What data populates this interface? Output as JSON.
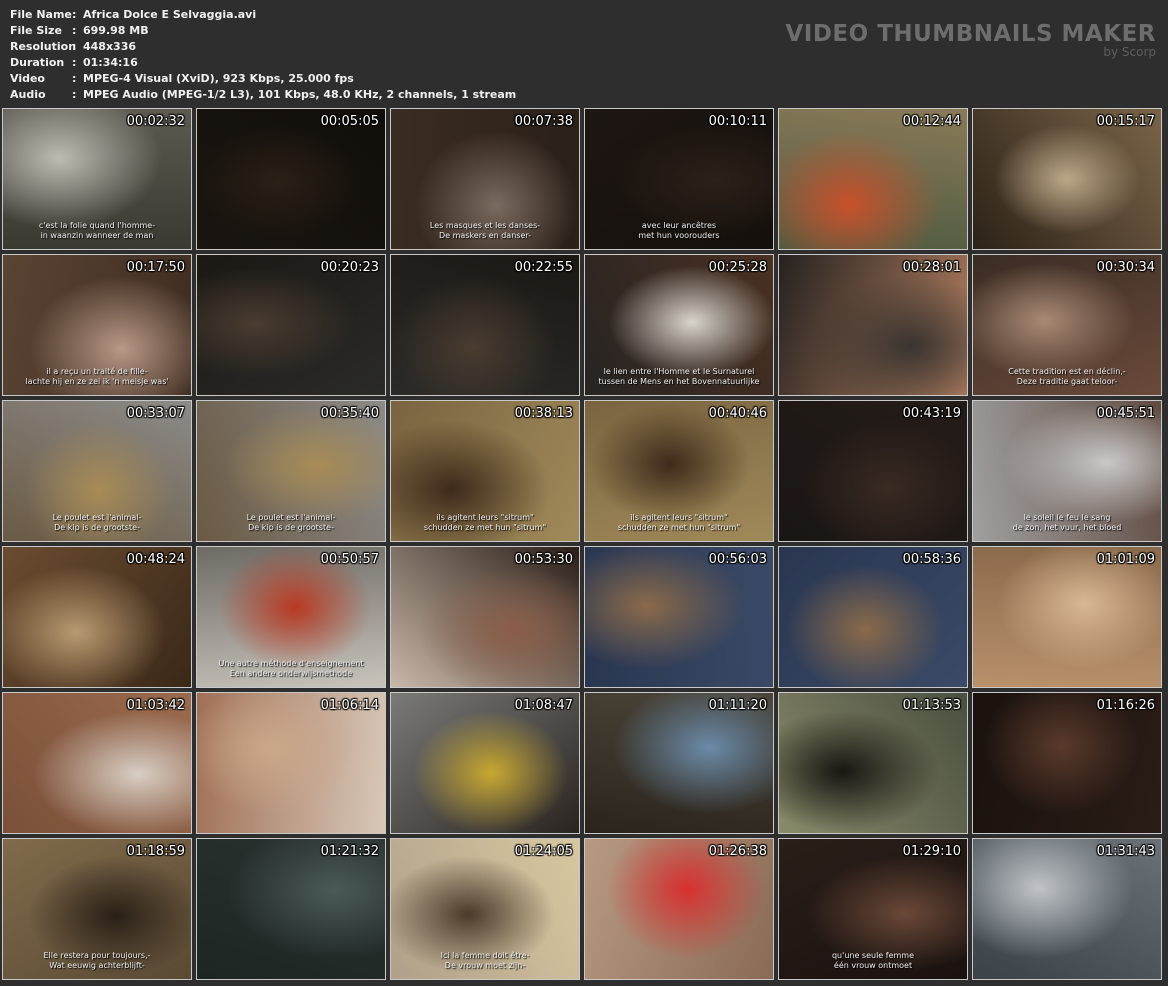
{
  "file_info": [
    {
      "key": "File Name",
      "value": "Africa Dolce E Selvaggia.avi"
    },
    {
      "key": "File Size",
      "value": "699.98 MB"
    },
    {
      "key": "Resolution",
      "value": "448x336"
    },
    {
      "key": "Duration",
      "value": "01:34:16"
    },
    {
      "key": "Video",
      "value": "MPEG-4 Visual (XviD), 923 Kbps, 25.000 fps"
    },
    {
      "key": "Audio",
      "value": "MPEG Audio (MPEG-1/2 L3), 101 Kbps, 48.0 KHz, 2 channels, 1 stream"
    }
  ],
  "separator": ":",
  "brand": {
    "title": "VIDEO THUMBNAILS MAKER",
    "subtitle": "by Scorp"
  },
  "thumbnails": [
    {
      "time": "00:02:32",
      "subtitle": "c'est la folie quand l'homme-\nin waanzin wanneer de man",
      "colors": [
        "#3a3a32",
        "#bdbbb2",
        "#5c5a50"
      ]
    },
    {
      "time": "00:05:05",
      "subtitle": "",
      "colors": [
        "#1a1510",
        "#2a2016",
        "#120e0a"
      ]
    },
    {
      "time": "00:07:38",
      "subtitle": "Les masques et les danses-\nDe maskers en danser-",
      "colors": [
        "#3b2c22",
        "#7a6a60",
        "#2a2018"
      ]
    },
    {
      "time": "00:10:11",
      "subtitle": "avec leur ancêtres\nmet hun voorouders",
      "colors": [
        "#1d1612",
        "#2c2119",
        "#15100c"
      ]
    },
    {
      "time": "00:12:44",
      "subtitle": "",
      "colors": [
        "#8a7a58",
        "#c8502a",
        "#4c5a40"
      ]
    },
    {
      "time": "00:15:17",
      "subtitle": "",
      "colors": [
        "#7a6448",
        "#bca888",
        "#2c2218"
      ]
    },
    {
      "time": "00:17:50",
      "subtitle": "il a reçu un traité de fille-\nlachte hij en ze zei ik 'n meisje was'",
      "colors": [
        "#3e2c20",
        "#b89886",
        "#5a4434"
      ]
    },
    {
      "time": "00:20:23",
      "subtitle": "",
      "colors": [
        "#2a2a28",
        "#4a3c30",
        "#1c1814"
      ]
    },
    {
      "time": "00:22:55",
      "subtitle": "",
      "colors": [
        "#2a2a28",
        "#4a3c30",
        "#1c1814"
      ]
    },
    {
      "time": "00:25:28",
      "subtitle": "le lien entre l'Homme et le Surnaturel\ntussen de Mens en het Bovennatuurlijke",
      "colors": [
        "#262422",
        "#d8d4cc",
        "#4a3022"
      ]
    },
    {
      "time": "00:28:01",
      "subtitle": "",
      "colors": [
        "#262220",
        "#3a3430",
        "#b48060"
      ]
    },
    {
      "time": "00:30:34",
      "subtitle": "Cette tradition est en déclin,-\nDeze traditie gaat teloor-",
      "colors": [
        "#3a2c24",
        "#a88a74",
        "#6a4a3a"
      ]
    },
    {
      "time": "00:33:07",
      "subtitle": "Le poulet est l'animal-\nDe kip is de grootste-",
      "colors": [
        "#8c8a88",
        "#a88c56",
        "#6a5a44"
      ]
    },
    {
      "time": "00:35:40",
      "subtitle": "Le poulet est l'animal-\nDe kip is de grootste-",
      "colors": [
        "#8c8a88",
        "#a88c56",
        "#6a5a44"
      ]
    },
    {
      "time": "00:38:13",
      "subtitle": "ils agitent leurs \"sitrum\"\nschudden ze met hun \"sitrum\"",
      "colors": [
        "#a08a5a",
        "#3e2a1a",
        "#7a6440"
      ]
    },
    {
      "time": "00:40:46",
      "subtitle": "ils agitent leurs \"sitrum\"\nschudden ze met hun \"sitrum\"",
      "colors": [
        "#a08a5a",
        "#3e2a1a",
        "#7a6440"
      ]
    },
    {
      "time": "00:43:19",
      "subtitle": "",
      "colors": [
        "#1a1614",
        "#3a2a22",
        "#241c18"
      ]
    },
    {
      "time": "00:45:51",
      "subtitle": "le soleil le feu le sang\nde zon, het vuur, het bloed",
      "colors": [
        "#a0a0a0",
        "#c8c8c8",
        "#604a40"
      ]
    },
    {
      "time": "00:48:24",
      "subtitle": "",
      "colors": [
        "#6a4c30",
        "#b89a70",
        "#3a2818"
      ]
    },
    {
      "time": "00:50:57",
      "subtitle": "Une autre méthode d'enseignement\nEen andere onderwijsmethode",
      "colors": [
        "#6e6a64",
        "#b83a22",
        "#c8c4bc"
      ]
    },
    {
      "time": "00:53:30",
      "subtitle": "",
      "colors": [
        "#2a1e18",
        "#8a5e48",
        "#c8b8a8"
      ]
    },
    {
      "time": "00:56:03",
      "subtitle": "",
      "colors": [
        "#3a4a66",
        "#8a6a4a",
        "#2a3650"
      ]
    },
    {
      "time": "00:58:36",
      "subtitle": "",
      "colors": [
        "#3a4a66",
        "#8a6a4a",
        "#2a3650"
      ]
    },
    {
      "time": "01:01:09",
      "subtitle": "",
      "colors": [
        "#b8906a",
        "#d8b894",
        "#8a6a4c"
      ]
    },
    {
      "time": "01:03:42",
      "subtitle": "",
      "colors": [
        "#7a5038",
        "#d8cec4",
        "#9a6a4e"
      ]
    },
    {
      "time": "01:06:14",
      "subtitle": "",
      "colors": [
        "#a07056",
        "#caa88a",
        "#d8c8b8"
      ]
    },
    {
      "time": "01:08:47",
      "subtitle": "",
      "colors": [
        "#7a7a78",
        "#c8a830",
        "#2a2420"
      ]
    },
    {
      "time": "01:11:20",
      "subtitle": "",
      "colors": [
        "#4a4438",
        "#6a8aa8",
        "#2a241c"
      ]
    },
    {
      "time": "01:13:53",
      "subtitle": "",
      "colors": [
        "#4a5040",
        "#1a1612",
        "#8a8a6a"
      ]
    },
    {
      "time": "01:16:26",
      "subtitle": "",
      "colors": [
        "#2a1c16",
        "#5a3a2c",
        "#1a120e"
      ]
    },
    {
      "time": "01:18:59",
      "subtitle": "Elle restera pour toujours,-\nWat eeuwig achterblijft-",
      "colors": [
        "#5a4a34",
        "#2a2018",
        "#806a4a"
      ]
    },
    {
      "time": "01:21:32",
      "subtitle": "",
      "colors": [
        "#1e2624",
        "#4a5a58",
        "#2a3230"
      ]
    },
    {
      "time": "01:24:05",
      "subtitle": "Ici la femme doit être-\nDe vrouw moet zijn-",
      "colors": [
        "#b0a08a",
        "#4a3a2a",
        "#d8c8a0"
      ]
    },
    {
      "time": "01:26:38",
      "subtitle": "",
      "colors": [
        "#b89a82",
        "#d83030",
        "#8a6a54"
      ]
    },
    {
      "time": "01:29:10",
      "subtitle": "qu'une seule femme\néén vrouw ontmoet",
      "colors": [
        "#2a1e18",
        "#6a4838",
        "#1a1210"
      ]
    },
    {
      "time": "01:31:43",
      "subtitle": "",
      "colors": [
        "#6a7278",
        "#c0c4c8",
        "#3a4248"
      ]
    }
  ]
}
